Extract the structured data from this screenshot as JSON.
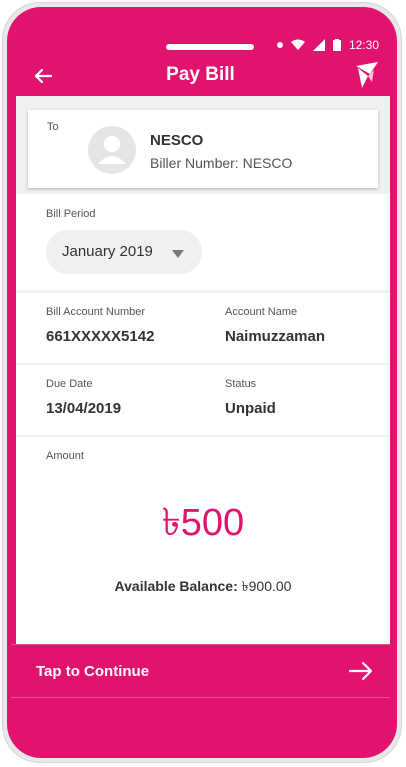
{
  "status_bar": {
    "time": "12:30"
  },
  "header": {
    "title": "Pay Bill",
    "back_icon": "arrow-left-icon",
    "logo_icon": "bkash-bird-icon"
  },
  "to": {
    "label": "To",
    "biller_name": "NESCO",
    "biller_number_label": "Biller Number:",
    "biller_number": "NESCO"
  },
  "bill_period": {
    "label": "Bill Period",
    "selected": "January 2019"
  },
  "account": {
    "number_label": "Bill Account Number",
    "number_value": "661XXXXX5142",
    "name_label": "Account Name",
    "name_value": "Naimuzzaman"
  },
  "due": {
    "date_label": "Due Date",
    "date_value": "13/04/2019",
    "status_label": "Status",
    "status_value": "Unpaid"
  },
  "amount": {
    "label": "Amount",
    "value": "৳500",
    "balance_label": "Available Balance:",
    "balance_value": "৳900.00"
  },
  "footer": {
    "continue_label": "Tap to Continue"
  },
  "colors": {
    "accent": "#e2136e",
    "background": "#f0f0f0"
  }
}
